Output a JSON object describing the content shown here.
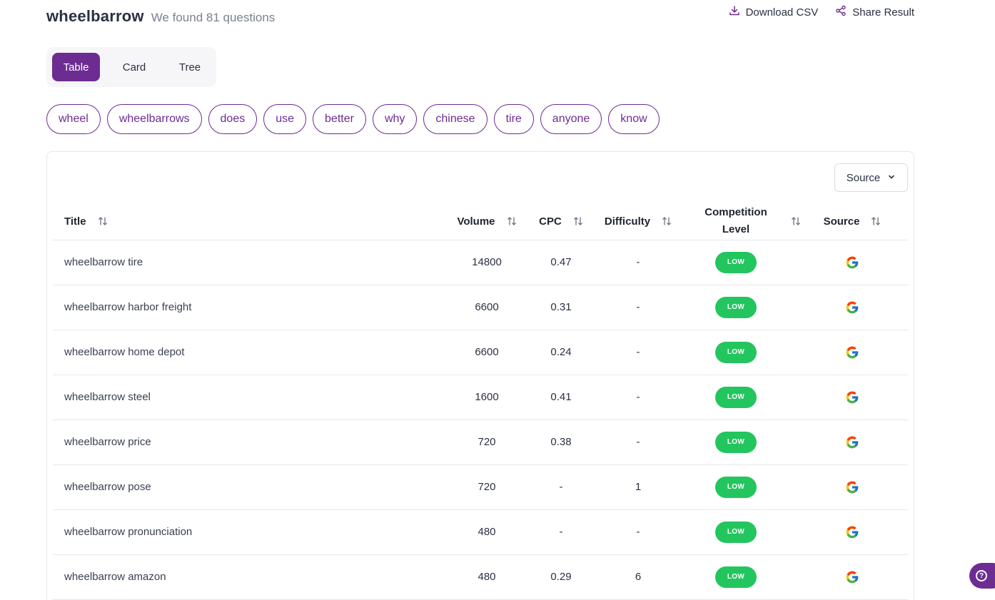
{
  "header": {
    "query": "wheelbarrow",
    "found_text": "We found 81 questions"
  },
  "actions": {
    "download_csv": "Download CSV",
    "share_result": "Share Result"
  },
  "view_tabs": [
    "Table",
    "Card",
    "Tree"
  ],
  "active_tab": "Table",
  "chips": [
    "wheel",
    "wheelbarrows",
    "does",
    "use",
    "better",
    "why",
    "chinese",
    "tire",
    "anyone",
    "know"
  ],
  "source_dropdown": {
    "label": "Source"
  },
  "table": {
    "headers": {
      "title": "Title",
      "volume": "Volume",
      "cpc": "CPC",
      "difficulty": "Difficulty",
      "competition": "Competition Level",
      "source": "Source"
    },
    "rows": [
      {
        "title": "wheelbarrow tire",
        "volume": "14800",
        "cpc": "0.47",
        "difficulty": "-",
        "competition": "LOW",
        "source": "google-icon"
      },
      {
        "title": "wheelbarrow harbor freight",
        "volume": "6600",
        "cpc": "0.31",
        "difficulty": "-",
        "competition": "LOW",
        "source": "google-icon"
      },
      {
        "title": "wheelbarrow home depot",
        "volume": "6600",
        "cpc": "0.24",
        "difficulty": "-",
        "competition": "LOW",
        "source": "google-icon"
      },
      {
        "title": "wheelbarrow steel",
        "volume": "1600",
        "cpc": "0.41",
        "difficulty": "-",
        "competition": "LOW",
        "source": "google-icon"
      },
      {
        "title": "wheelbarrow price",
        "volume": "720",
        "cpc": "0.38",
        "difficulty": "-",
        "competition": "LOW",
        "source": "google-icon"
      },
      {
        "title": "wheelbarrow pose",
        "volume": "720",
        "cpc": "-",
        "difficulty": "1",
        "competition": "LOW",
        "source": "google-icon"
      },
      {
        "title": "wheelbarrow pronunciation",
        "volume": "480",
        "cpc": "-",
        "difficulty": "-",
        "competition": "LOW",
        "source": "google-icon"
      },
      {
        "title": "wheelbarrow amazon",
        "volume": "480",
        "cpc": "0.29",
        "difficulty": "6",
        "competition": "LOW",
        "source": "google-icon"
      }
    ]
  },
  "colors": {
    "brand": "#6c2c91",
    "low_badge": "#22c55e"
  },
  "help_widget": {
    "icon": "help-icon"
  }
}
